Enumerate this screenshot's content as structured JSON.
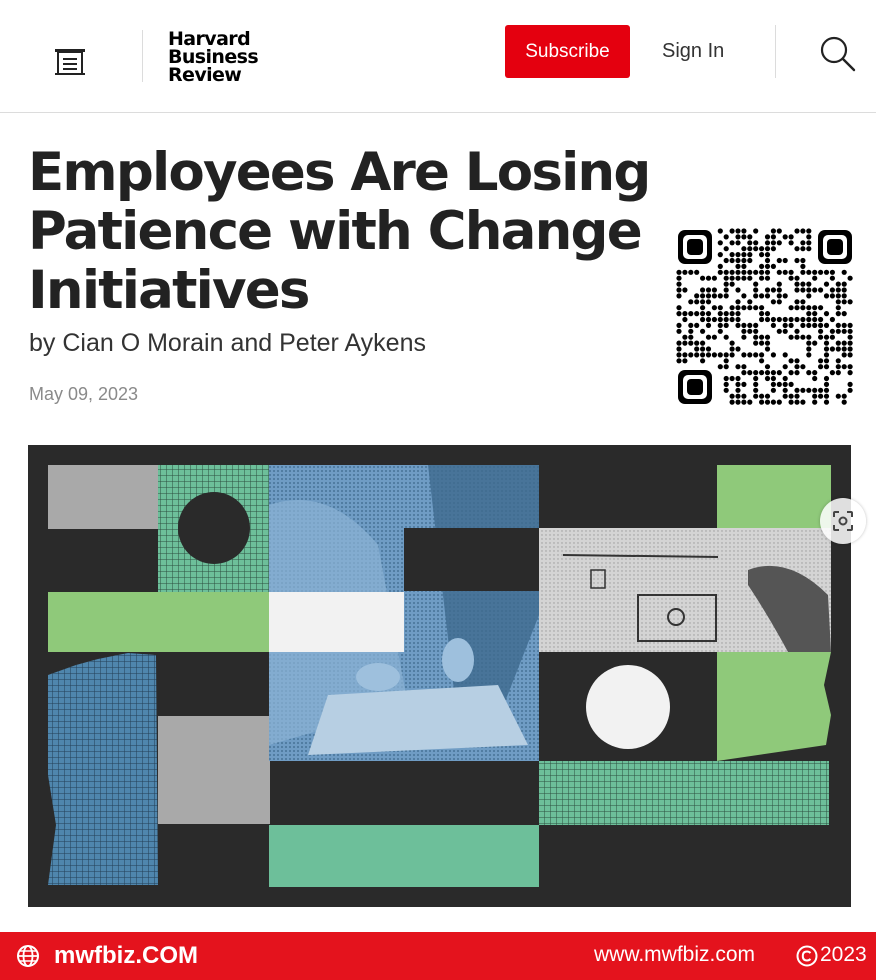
{
  "header": {
    "logo_lines": [
      "Harvard",
      "Business",
      "Review"
    ],
    "subscribe_label": "Subscribe",
    "signin_label": "Sign In",
    "menu_icon": "menu-icon",
    "search_icon": "search-icon"
  },
  "article": {
    "title": "Employees Are Losing Patience with Change Initiatives",
    "byline": "by Cian O Morain and Peter Aykens",
    "date": "May 09, 2023"
  },
  "footer": {
    "brand": "mwfbiz.COM",
    "url": "www.mwfbiz.com",
    "year": "2023"
  },
  "colors": {
    "brand_red": "#e4000f",
    "footer_red": "#e4131d",
    "hero_dark": "#2a2a2a",
    "hero_green": "#8fc97a",
    "hero_teal": "#6dbf9a",
    "hero_blue": "#4f86ad",
    "hero_gray": "#a9a9a9"
  }
}
